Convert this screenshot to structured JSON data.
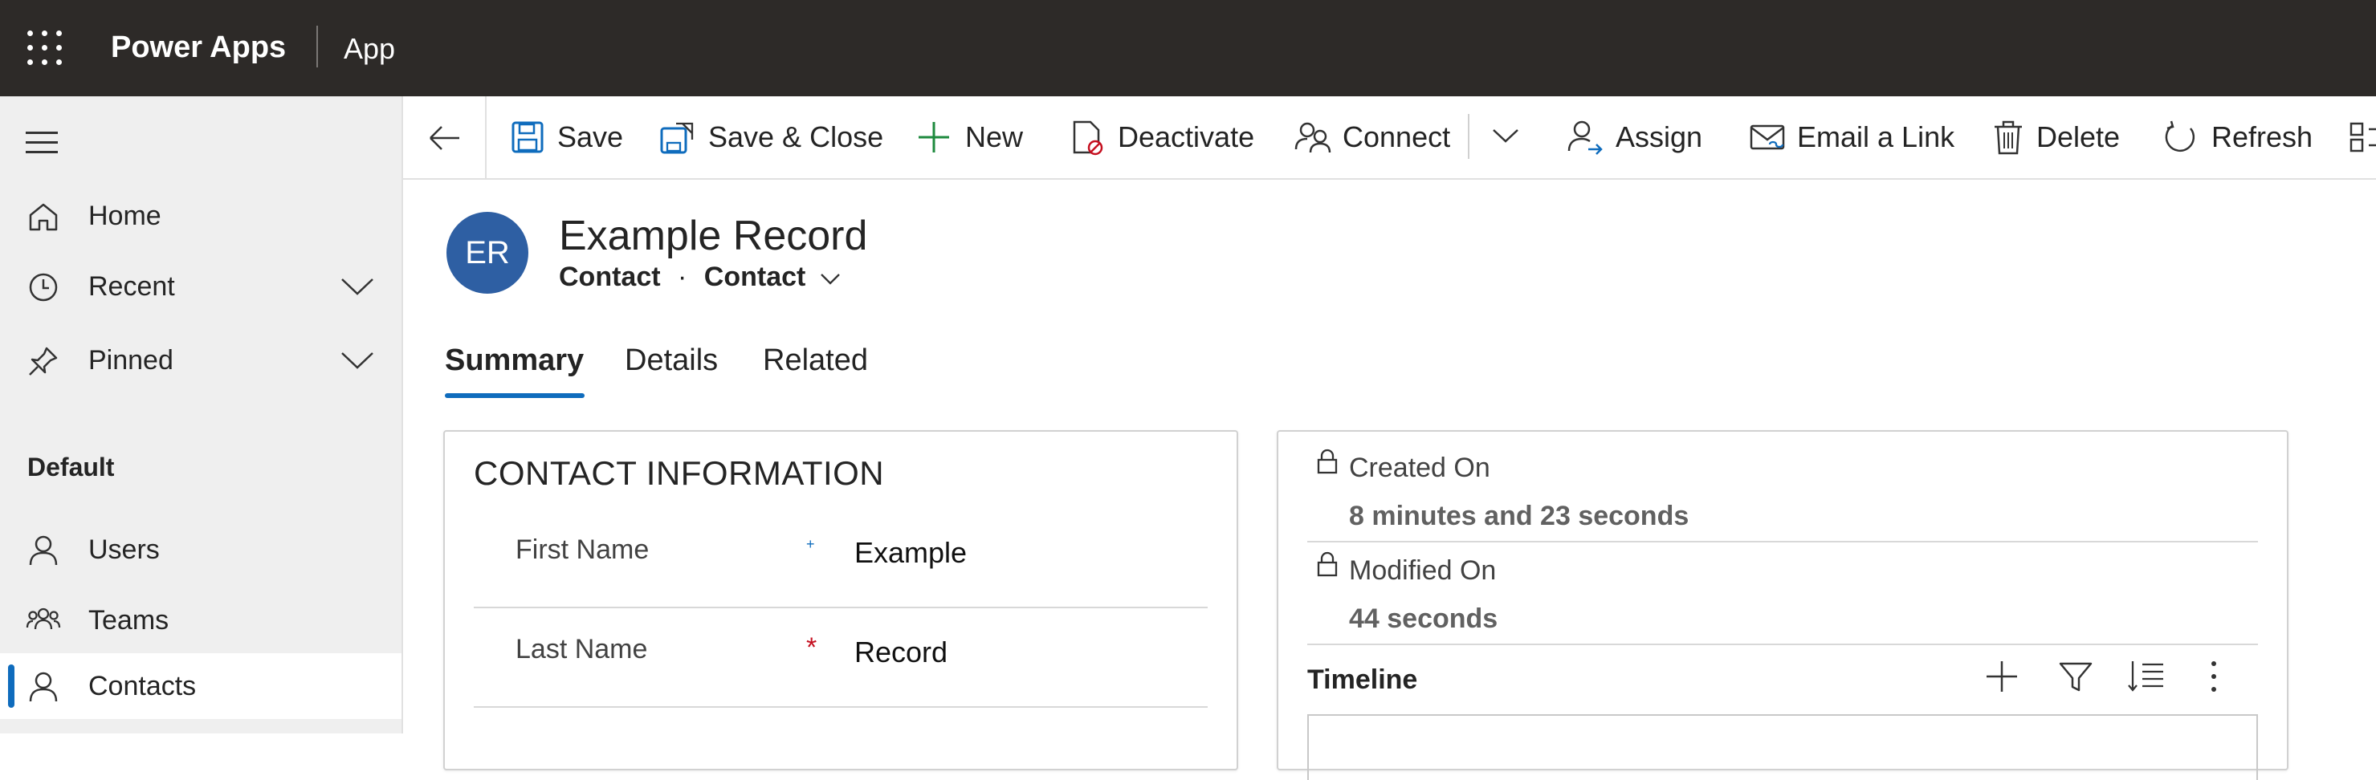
{
  "topbar": {
    "brand": "Power Apps",
    "app": "App"
  },
  "sidebar": {
    "items": [
      {
        "label": "Home"
      },
      {
        "label": "Recent"
      },
      {
        "label": "Pinned"
      }
    ],
    "section": "Default",
    "section_items": [
      {
        "label": "Users"
      },
      {
        "label": "Teams"
      },
      {
        "label": "Contacts",
        "selected": true
      }
    ]
  },
  "commands": {
    "save": "Save",
    "save_close": "Save & Close",
    "new": "New",
    "deactivate": "Deactivate",
    "connect": "Connect",
    "assign": "Assign",
    "email_link": "Email a Link",
    "delete": "Delete",
    "refresh": "Refresh"
  },
  "record": {
    "initials": "ER",
    "title": "Example Record",
    "entity": "Contact",
    "separator": "·",
    "form": "Contact"
  },
  "tabs": [
    "Summary",
    "Details",
    "Related"
  ],
  "contact_info": {
    "title": "CONTACT INFORMATION",
    "fields": [
      {
        "label": "First Name",
        "required_marker": "+",
        "value": "Example"
      },
      {
        "label": "Last Name",
        "required_marker": "*",
        "value": "Record"
      }
    ]
  },
  "metadata": {
    "created_label": "Created On",
    "created_value": "8 minutes and 23 seconds",
    "modified_label": "Modified On",
    "modified_value": "44 seconds",
    "timeline_title": "Timeline"
  },
  "colors": {
    "topbar": "#2d2a28",
    "accent": "#0f6cbd",
    "avatar": "#2e5fa3",
    "required": "#c50f1f"
  },
  "icons": [
    "waffle-icon",
    "hamburger-icon",
    "home-icon",
    "clock-icon",
    "pin-icon",
    "user-icon",
    "team-icon",
    "back-arrow-icon",
    "save-icon",
    "save-close-icon",
    "plus-icon",
    "deactivate-icon",
    "connect-icon",
    "chevron-down-icon",
    "assign-icon",
    "email-link-icon",
    "delete-icon",
    "refresh-icon",
    "lock-icon",
    "filter-icon",
    "sort-icon",
    "more-icon"
  ]
}
